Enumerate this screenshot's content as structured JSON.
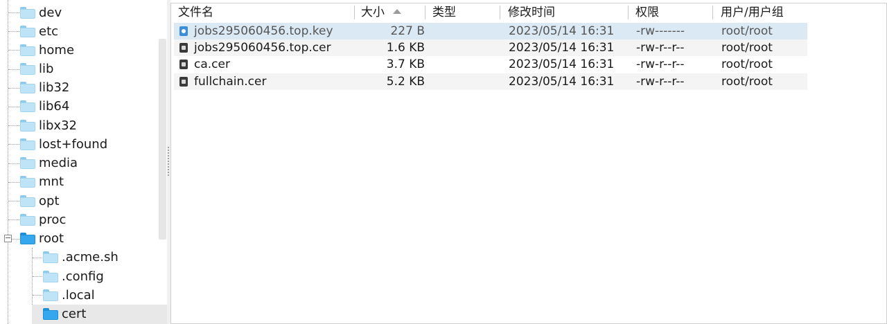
{
  "tree": {
    "items": [
      {
        "label": "dev",
        "icon": "folder-icon"
      },
      {
        "label": "etc",
        "icon": "folder-icon"
      },
      {
        "label": "home",
        "icon": "folder-icon"
      },
      {
        "label": "lib",
        "icon": "folder-link-icon"
      },
      {
        "label": "lib32",
        "icon": "folder-link-icon"
      },
      {
        "label": "lib64",
        "icon": "folder-link-icon"
      },
      {
        "label": "libx32",
        "icon": "folder-link-icon"
      },
      {
        "label": "lost+found",
        "icon": "folder-icon"
      },
      {
        "label": "media",
        "icon": "folder-icon"
      },
      {
        "label": "mnt",
        "icon": "folder-icon"
      },
      {
        "label": "opt",
        "icon": "folder-icon"
      },
      {
        "label": "proc",
        "icon": "folder-icon"
      },
      {
        "label": "root",
        "icon": "folder-open-icon",
        "expanded": true
      },
      {
        "label": ".acme.sh",
        "icon": "folder-icon"
      },
      {
        "label": ".config",
        "icon": "folder-icon"
      },
      {
        "label": ".local",
        "icon": "folder-icon"
      },
      {
        "label": "cert",
        "icon": "folder-open-icon",
        "selected": true
      }
    ],
    "collapse_symbol": "−"
  },
  "columns": {
    "name": "文件名",
    "size": "大小",
    "type": "类型",
    "modified": "修改时间",
    "permissions": "权限",
    "owner": "用户/用户组",
    "sort_column": "size",
    "sort_direction": "ascending"
  },
  "files": [
    {
      "name": "jobs295060456.top.key",
      "size": "227 B",
      "type": "",
      "modified": "2023/05/14 16:31",
      "permissions": "-rw-------",
      "owner": "root/root",
      "icon": "key-file-icon",
      "selected": true
    },
    {
      "name": "jobs295060456.top.cer",
      "size": "1.6 KB",
      "type": "",
      "modified": "2023/05/14 16:31",
      "permissions": "-rw-r--r--",
      "owner": "root/root",
      "icon": "certificate-file-icon"
    },
    {
      "name": "ca.cer",
      "size": "3.7 KB",
      "type": "",
      "modified": "2023/05/14 16:31",
      "permissions": "-rw-r--r--",
      "owner": "root/root",
      "icon": "certificate-file-icon"
    },
    {
      "name": "fullchain.cer",
      "size": "5.2 KB",
      "type": "",
      "modified": "2023/05/14 16:31",
      "permissions": "-rw-r--r--",
      "owner": "root/root",
      "icon": "certificate-file-icon"
    }
  ]
}
